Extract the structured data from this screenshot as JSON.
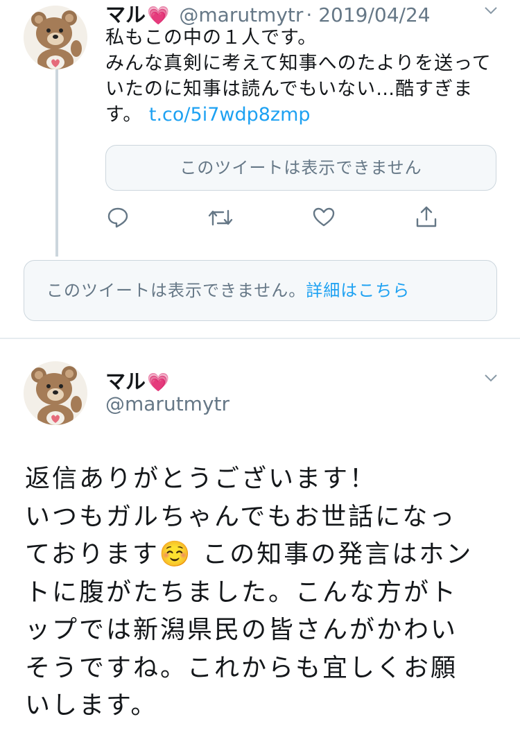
{
  "reply_tweet": {
    "author_name": "マル",
    "author_emoji": "💗",
    "handle": "@marutmytr",
    "date": "· 2019/04/24",
    "text_lines": [
      "私もこの中の１人です。",
      "みんな真剣に考えて知事へのたよりを送って",
      "いたのに知事は読んでもいない…酷すぎま",
      "す。 "
    ],
    "link": "t.co/5i7wdp8zmp",
    "quoted_unavailable": "このツイートは表示できません",
    "actions": [
      "reply-icon",
      "retweet-icon",
      "like-icon",
      "share-icon"
    ]
  },
  "unavailable_notice": {
    "text": "このツイートは表示できません。",
    "more_link": "詳細はこちら"
  },
  "main_tweet": {
    "author_name": "マル",
    "author_emoji": "💗",
    "handle": "@marutmytr",
    "text_lines": [
      "返信ありがとうございます！",
      "いつもガルちゃんでもお世話になっ",
      "ております☺️ この知事の発言はホン",
      "トに腹がたちました。こんな方がト",
      "ップでは新潟県民の皆さんがかわい",
      "そうですね。これからも宜しくお願",
      "いします。"
    ]
  },
  "colors": {
    "accent": "#1da1f2",
    "secondary_text": "#657786",
    "border": "#ccd6dd"
  }
}
